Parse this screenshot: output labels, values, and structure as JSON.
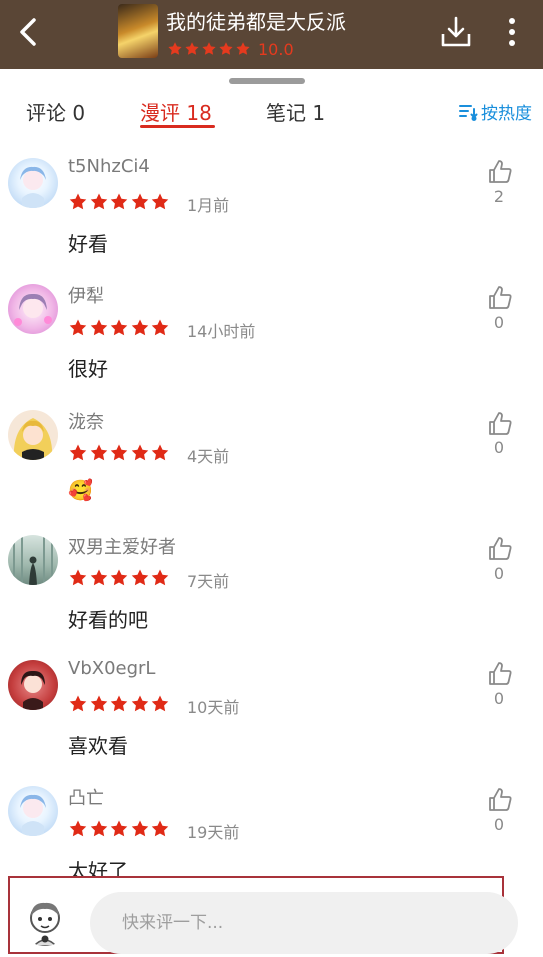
{
  "header": {
    "back_icon": "chevron-left-icon",
    "title": "我的徒弟都是大反派",
    "rating_stars": 5,
    "rating_score": "10.0",
    "download_icon": "download-icon",
    "more_icon": "more-vertical-icon"
  },
  "tabs": [
    {
      "label": "评论 0"
    },
    {
      "label": "漫评 18"
    },
    {
      "label": "笔记 1"
    }
  ],
  "sort_label": "按热度",
  "colors": {
    "header_bg": "#5a4636",
    "accent_red": "#d92b1f",
    "star_red": "#e02a16",
    "sort_blue": "#1a8fdc"
  },
  "comments": [
    {
      "user": "t5NhzCi4",
      "stars": 5,
      "time": "1月前",
      "text": "好看",
      "likes": "2"
    },
    {
      "user": "伊犁",
      "stars": 5,
      "time": "14小时前",
      "text": "很好",
      "likes": "0"
    },
    {
      "user": "泷奈",
      "stars": 5,
      "time": "4天前",
      "text": "🥰",
      "likes": "0"
    },
    {
      "user": "双男主爱好者",
      "stars": 5,
      "time": "7天前",
      "text": "好看的吧",
      "likes": "0"
    },
    {
      "user": "VbX0egrL",
      "stars": 5,
      "time": "10天前",
      "text": "喜欢看",
      "likes": "0"
    },
    {
      "user": "凸亡",
      "stars": 5,
      "time": "19天前",
      "text": "太好了",
      "likes": "0"
    }
  ],
  "input": {
    "placeholder": "快来评一下..."
  }
}
